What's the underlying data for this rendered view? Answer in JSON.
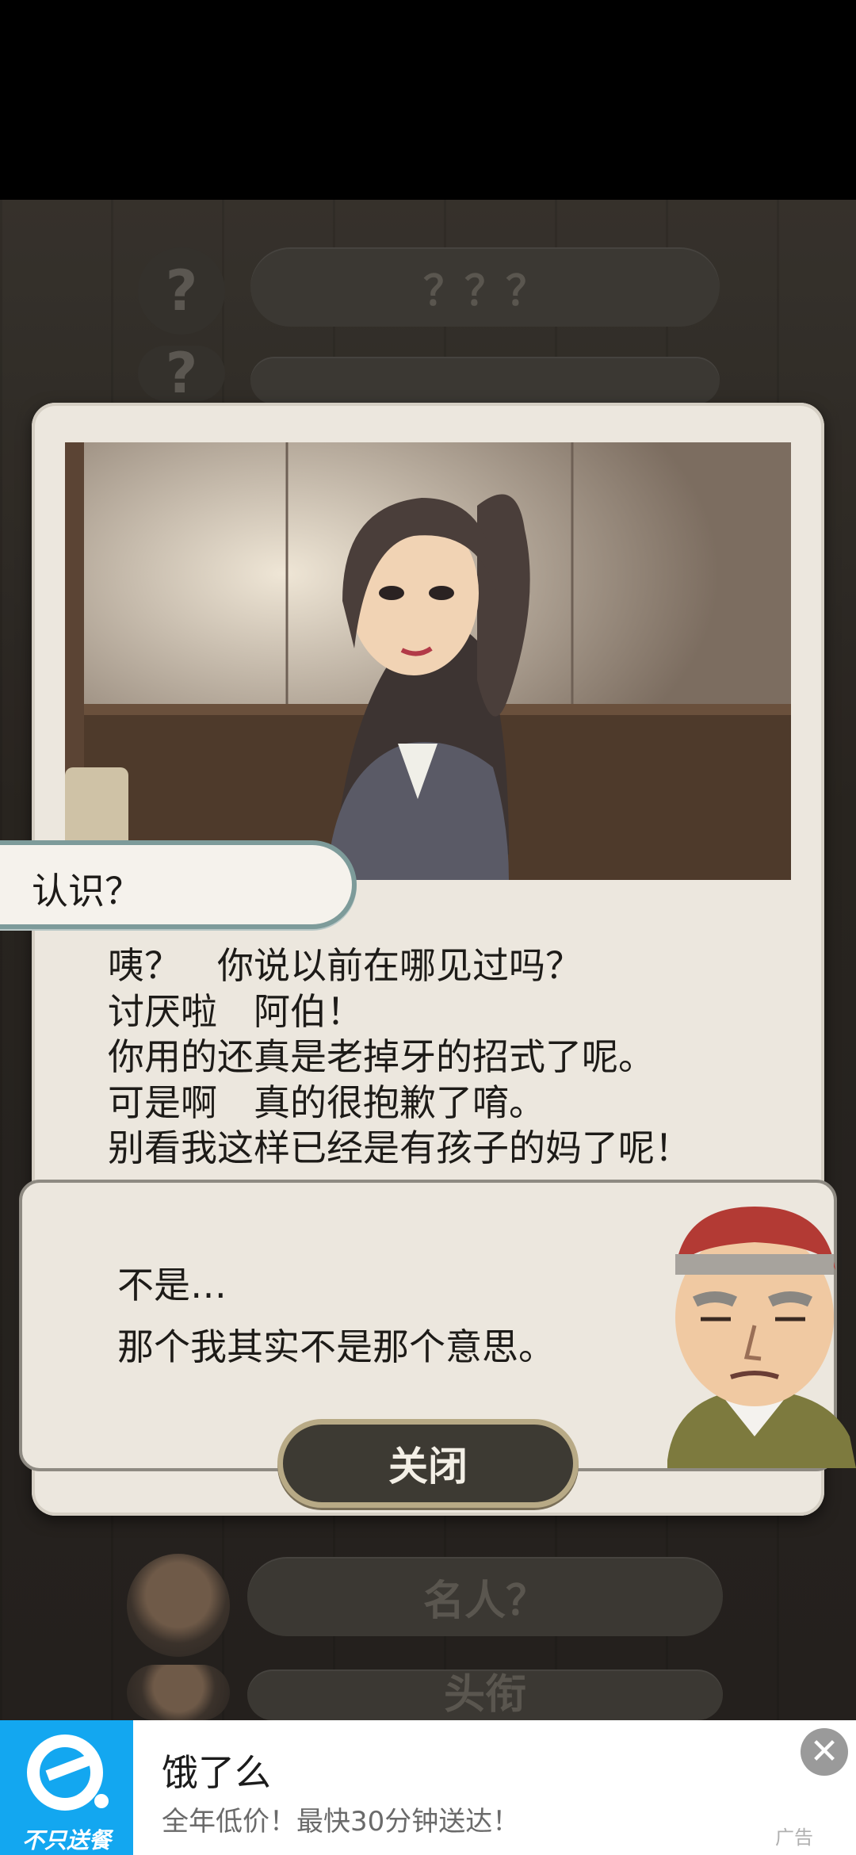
{
  "background_list": {
    "unknown_marks": [
      "?",
      "?"
    ],
    "rows": [
      "？？？",
      "名人？",
      "头衔"
    ]
  },
  "dialog": {
    "title": "认识？",
    "lines": [
      "咦？　你说以前在哪见过吗？",
      "讨厌啦　阿伯！",
      "你用的还真是老掉牙的招式了呢。",
      "可是啊　真的很抱歉了唷。",
      "别看我这样已经是有孩子的妈了呢！"
    ],
    "reply_lines": [
      "不是…",
      "那个我其实不是那个意思。"
    ],
    "close_label": "关闭"
  },
  "ad": {
    "logo_caption": "不只送餐",
    "title": "饿了么",
    "subtitle": "全年低价！最快30分钟送达！",
    "tag": "广告",
    "close_glyph": "✕",
    "brand_color": "#13a7f0"
  }
}
